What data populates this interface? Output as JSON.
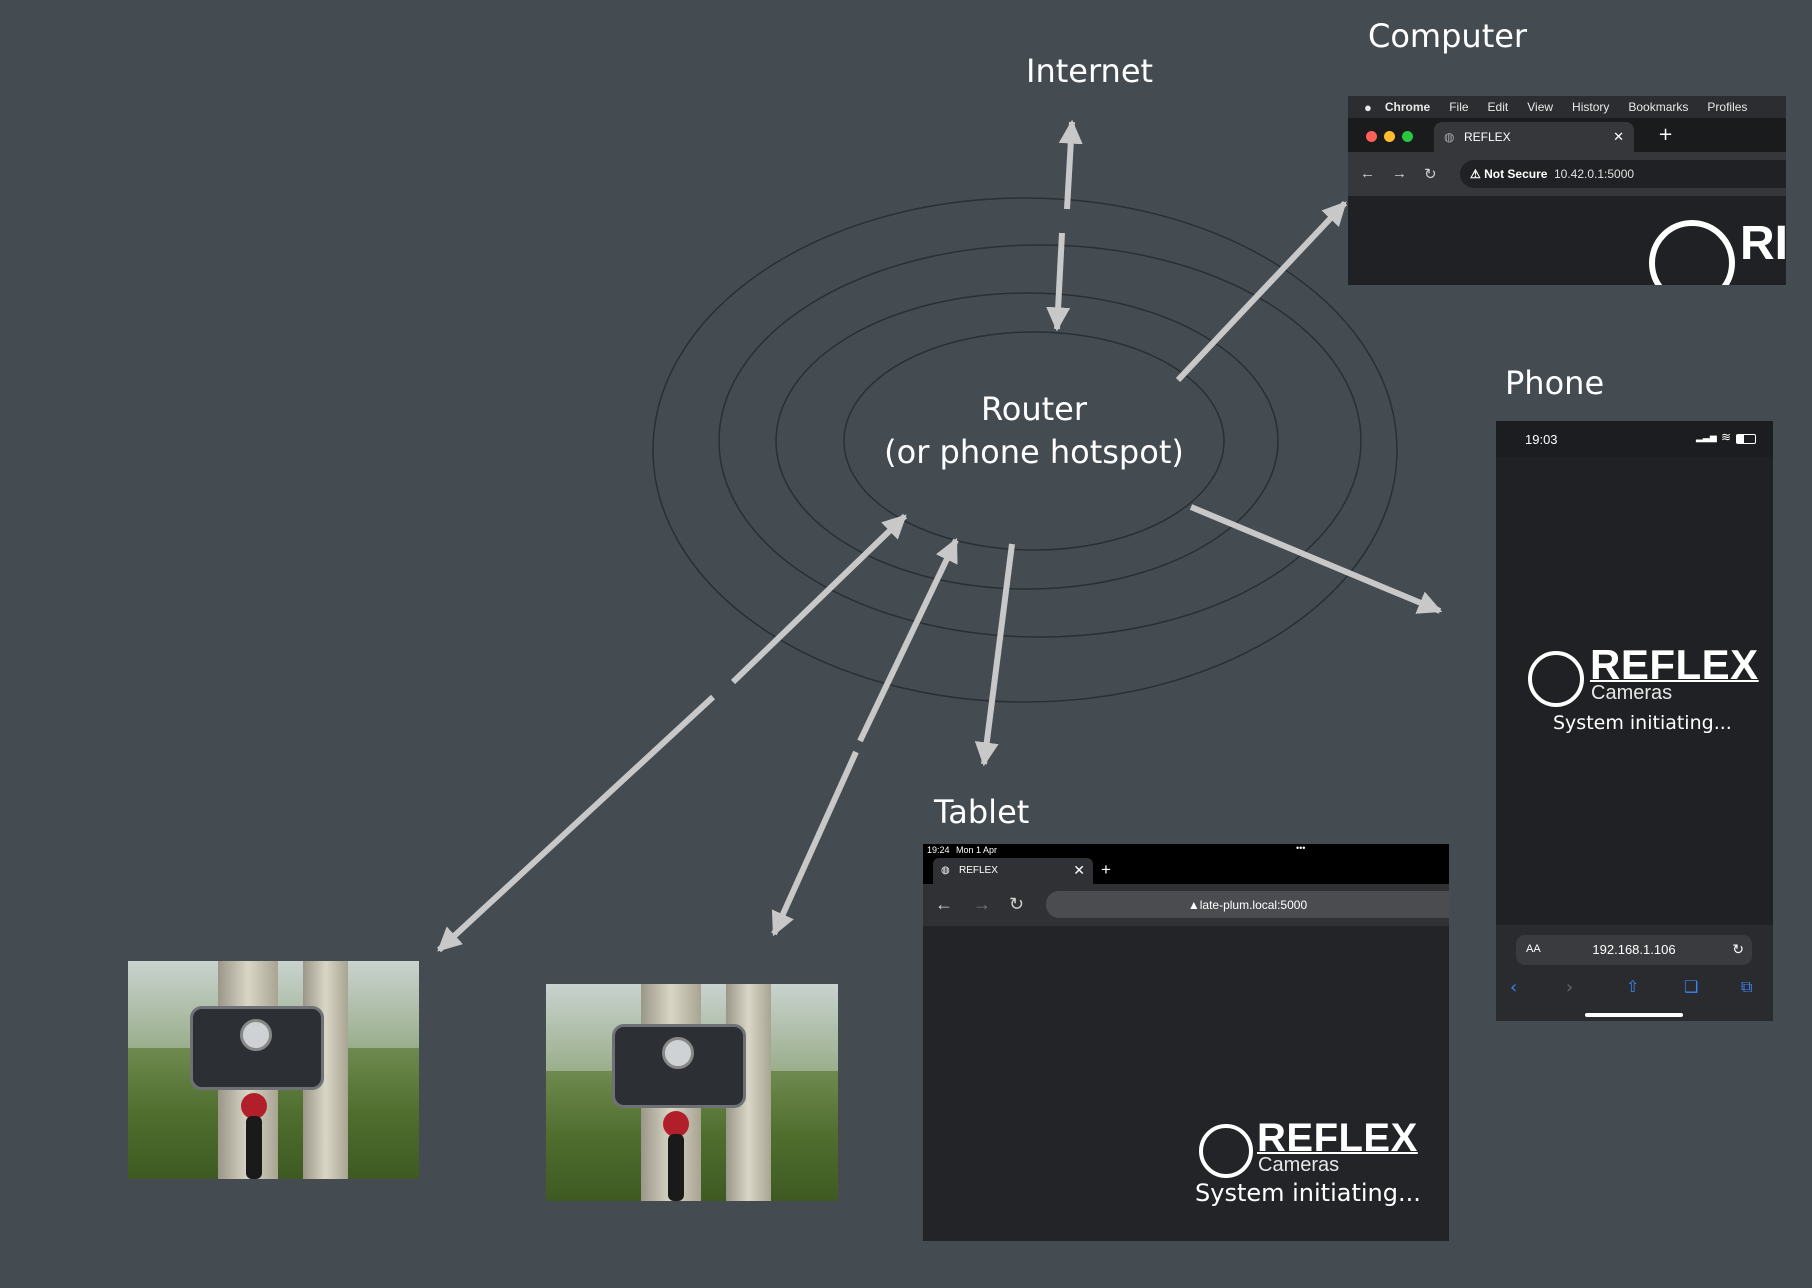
{
  "labels": {
    "internet": "Internet",
    "computer": "Computer",
    "phone": "Phone",
    "tablet": "Tablet",
    "router_line1": "Router",
    "router_line2": "(or phone hotspot)"
  },
  "computer": {
    "menu": [
      "Chrome",
      "File",
      "Edit",
      "View",
      "History",
      "Bookmarks",
      "Profiles"
    ],
    "tab_title": "REFLEX",
    "security_warning": "Not Secure",
    "url": "10.42.0.1:5000",
    "logo_partial": "RI"
  },
  "phone": {
    "time": "19:03",
    "brand": "REFLEX",
    "subbrand": "Cameras",
    "status": "System initiating...",
    "url": "192.168.1.106",
    "text_size_label": "AA"
  },
  "tablet": {
    "time": "19:24",
    "date": "Mon 1 Apr",
    "tab_title": "REFLEX",
    "url": "late-plum.local:5000",
    "brand": "REFLEX",
    "subbrand": "Cameras",
    "status": "System initiating..."
  },
  "colors": {
    "background": "#444c52",
    "arrow": "#c8c8c8",
    "ring": "#2a2f33",
    "accent_blue": "#3b82f6"
  }
}
